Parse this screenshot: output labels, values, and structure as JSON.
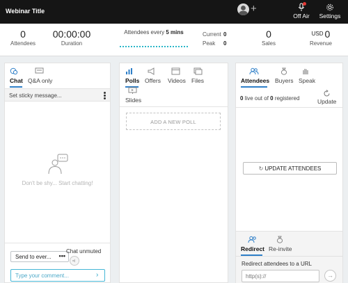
{
  "header": {
    "title": "Webinar Title",
    "off_air_label": "Off Air",
    "settings_label": "Settings"
  },
  "stats": {
    "attendees": {
      "value": "0",
      "label": "Attendees"
    },
    "duration": {
      "value": "00:00:00",
      "label": "Duration"
    },
    "attendees_every": {
      "prefix": "Attendees every ",
      "value": "5 mins"
    },
    "current": {
      "label": "Current",
      "value": "0"
    },
    "peak": {
      "label": "Peak",
      "value": "0"
    },
    "sales": {
      "value": "0",
      "label": "Sales"
    },
    "revenue": {
      "currency": "USD",
      "value": "0",
      "label": "Revenue"
    }
  },
  "chat_panel": {
    "tabs": [
      "Chat",
      "Q&A only"
    ],
    "sticky_placeholder": "Set sticky message...",
    "empty_text": "Don't be shy... Start chatting!",
    "send_to": "Send to ever...",
    "send_more": "•••",
    "chat_status": "Chat unmuted",
    "comment_placeholder": "Type your comment..."
  },
  "polls_panel": {
    "tabs": [
      "Polls",
      "Offers",
      "Videos",
      "Files",
      "Slides"
    ],
    "add_poll": "ADD A NEW POLL"
  },
  "attendees_panel": {
    "tabs": [
      "Attendees",
      "Buyers",
      "Speak"
    ],
    "status": {
      "live": "0",
      "mid": " live out of ",
      "registered": "0",
      "suffix": " registered"
    },
    "update_label": "Update",
    "update_button": "UPDATE ATTENDEES",
    "redirect_tabs": [
      "Redirect",
      "Re-invite"
    ],
    "redirect_label": "Redirect attendees to a URL",
    "url_placeholder": "http(s)://"
  },
  "colors": {
    "accent": "#2e7fc8",
    "topbar": "#151515",
    "alert": "#e53935"
  }
}
